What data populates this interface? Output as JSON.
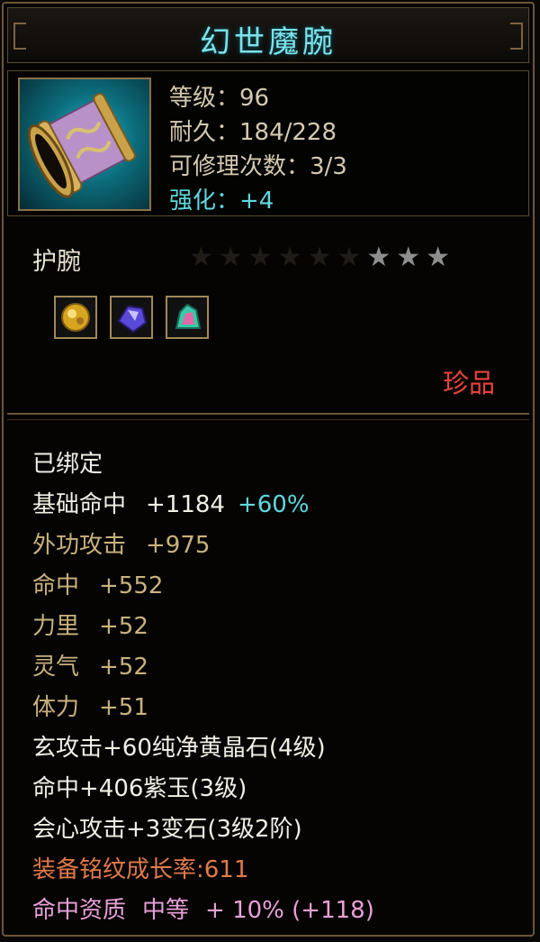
{
  "item": {
    "name": "幻世魔腕",
    "stats": {
      "level_label": "等级：96",
      "durability_label": "耐久：184/228",
      "repair_label": "可修理次数：3/3",
      "enhance_label": "强化：+4"
    },
    "type": "护腕",
    "stars": {
      "total": 9,
      "lit": 3,
      "lit_glyphs": "★★★",
      "dim_glyphs": "★★★★★★"
    },
    "gems": [
      {
        "name": "yellow-gem-icon",
        "color": "#d8a520"
      },
      {
        "name": "purple-gem-icon",
        "color": "#5a4ad8"
      },
      {
        "name": "green-gem-icon",
        "color": "#3ac8a8"
      }
    ],
    "rarity": "珍品"
  },
  "attributes": {
    "bound": "已绑定",
    "base_hit_name": "基础命中",
    "base_hit_value": "+1184",
    "base_hit_bonus": "+60%",
    "outer_attack_name": "外功攻击",
    "outer_attack_value": "+975",
    "hit_name": "命中",
    "hit_value": "+552",
    "strength_name": "力里",
    "strength_value": "+52",
    "spirit_name": "灵气",
    "spirit_value": "+52",
    "stamina_name": "体力",
    "stamina_value": "+51",
    "gem_line_1": "玄攻击+60纯净黄晶石(4级)",
    "gem_line_2": "命中+406紫玉(3级)",
    "gem_line_3": "会心攻击+3变石(3级2阶)",
    "inscription": "装备铭纹成长率:611",
    "aptitude_name": "命中资质",
    "aptitude_grade": "中等",
    "aptitude_bonus": "+ 10% (+118)"
  },
  "colors": {
    "title": "#7fe2ea",
    "cyan": "#5fd8e0",
    "gold": "#c8b27c",
    "rarity_red": "#e8443a",
    "inscription_orange": "#e07a4a",
    "aptitude_pink": "#e8a0d8",
    "frame": "#6b5636"
  }
}
